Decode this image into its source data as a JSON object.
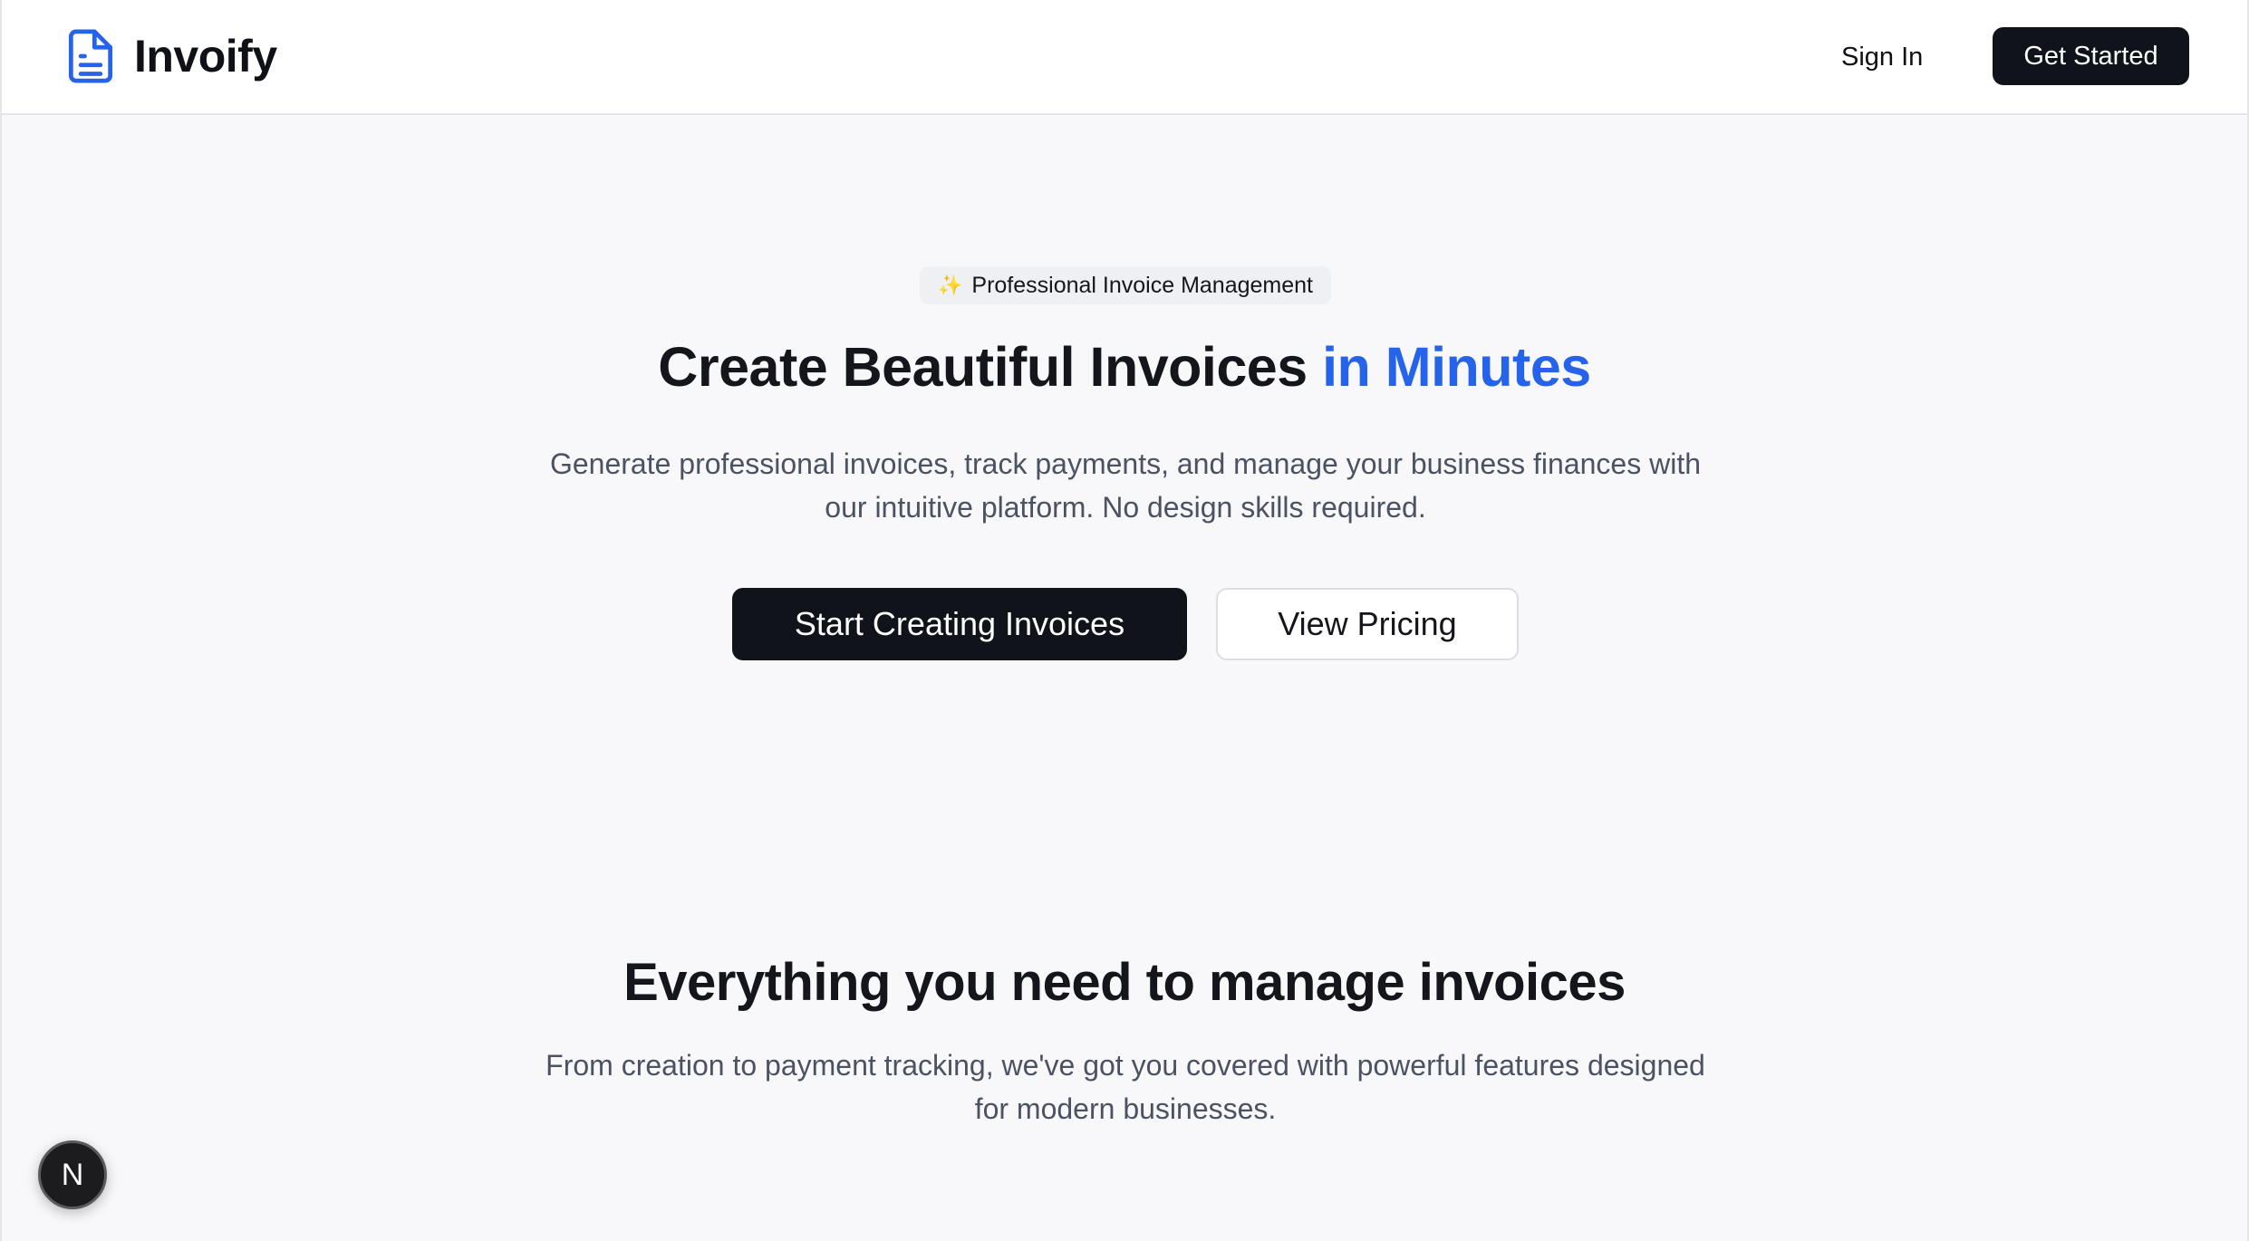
{
  "nav": {
    "brand_name": "Invoify",
    "brand_icon": "file-text-icon",
    "signin_label": "Sign In",
    "get_started_label": "Get Started"
  },
  "hero": {
    "badge_icon": "sparkles-icon",
    "badge_text": "Professional Invoice Management",
    "title_main": "Create Beautiful Invoices ",
    "title_accent": "in Minutes",
    "subtitle_line1": "Generate professional invoices, track payments, and manage your business finances with",
    "subtitle_line2": "our intuitive platform. No design skills required.",
    "primary_cta": "Start Creating Invoices",
    "secondary_cta": "View Pricing"
  },
  "features": {
    "title": "Everything you need to manage invoices",
    "subtitle_line1": "From creation to payment tracking, we've got you covered with powerful features designed",
    "subtitle_line2": "for modern businesses."
  },
  "dev_badge": {
    "letter": "N",
    "icon": "nextjs-icon"
  },
  "colors": {
    "accent": "#2563eb",
    "dark": "#10131a",
    "background": "#f8f8fb"
  }
}
